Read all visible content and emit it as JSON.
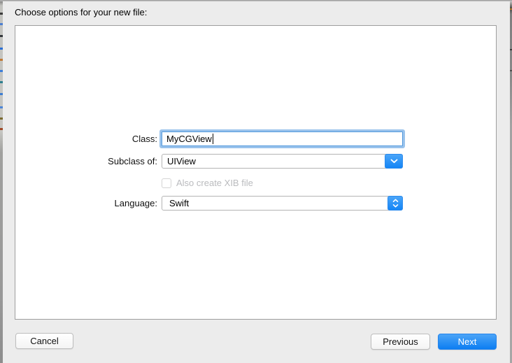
{
  "window": {
    "title": "Choose options for your new file:"
  },
  "form": {
    "class": {
      "label": "Class:",
      "value": "MyCGView"
    },
    "subclass": {
      "label": "Subclass of:",
      "value": "UIView"
    },
    "xib_checkbox": {
      "label": "Also create XIB file",
      "checked": false,
      "enabled": false
    },
    "language": {
      "label": "Language:",
      "value": "Swift"
    }
  },
  "buttons": {
    "cancel": "Cancel",
    "previous": "Previous",
    "next": "Next"
  },
  "colors": {
    "dialog_bg": "#ececec",
    "accent_blue": "#1485f6",
    "next_button_gradient_top": "#4ba4f7",
    "next_button_gradient_bottom": "#0c7ef2",
    "focus_ring": "#78afe6",
    "disabled_text": "#babbbe",
    "panel_border": "#9e9e9e"
  },
  "icons": {
    "subclass_dropdown": "chevron-down",
    "language_popup": "chevron-up-down"
  }
}
